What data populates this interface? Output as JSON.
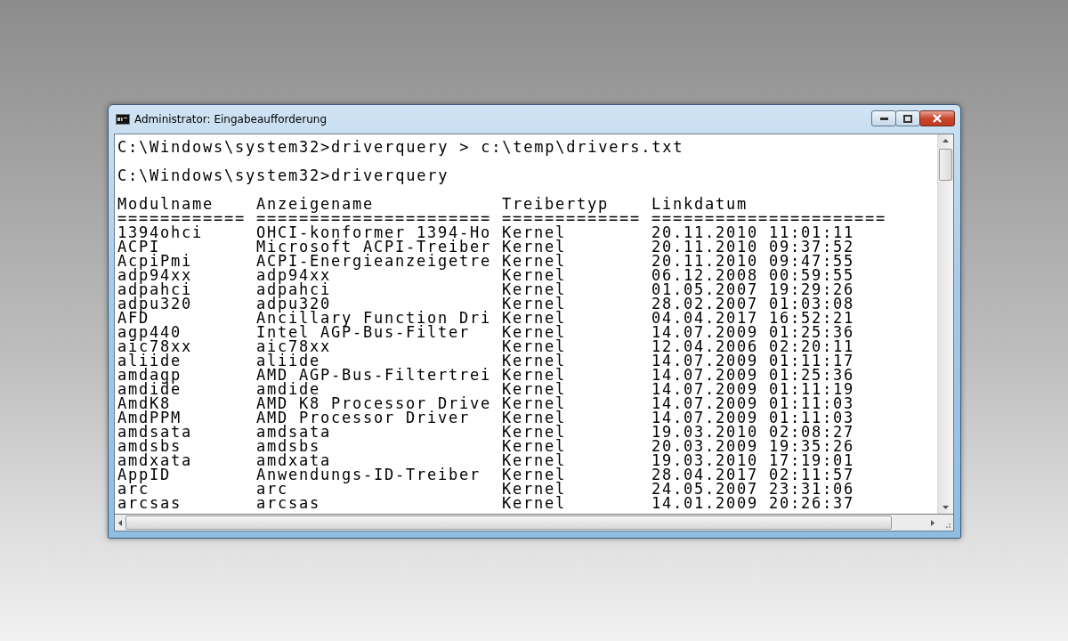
{
  "window": {
    "title": "Administrator: Eingabeaufforderung"
  },
  "console": {
    "commands": [
      "C:\\Windows\\system32>driverquery > c:\\temp\\drivers.txt",
      "C:\\Windows\\system32>driverquery"
    ],
    "table": {
      "columns": [
        {
          "label": "Modulname",
          "rule": "============"
        },
        {
          "label": "Anzeigename",
          "rule": "======================"
        },
        {
          "label": "Treibertyp",
          "rule": "============="
        },
        {
          "label": "Linkdatum",
          "rule": "======================"
        }
      ],
      "rows": [
        [
          "1394ohci",
          "OHCI-konformer 1394-Ho",
          "Kernel",
          "20.11.2010 11:01:11"
        ],
        [
          "ACPI",
          "Microsoft ACPI-Treiber",
          "Kernel",
          "20.11.2010 09:37:52"
        ],
        [
          "AcpiPmi",
          "ACPI-Energieanzeigetre",
          "Kernel",
          "20.11.2010 09:47:55"
        ],
        [
          "adp94xx",
          "adp94xx",
          "Kernel",
          "06.12.2008 00:59:55"
        ],
        [
          "adpahci",
          "adpahci",
          "Kernel",
          "01.05.2007 19:29:26"
        ],
        [
          "adpu320",
          "adpu320",
          "Kernel",
          "28.02.2007 01:03:08"
        ],
        [
          "AFD",
          "Ancillary Function Dri",
          "Kernel",
          "04.04.2017 16:52:21"
        ],
        [
          "agp440",
          "Intel AGP-Bus-Filter",
          "Kernel",
          "14.07.2009 01:25:36"
        ],
        [
          "aic78xx",
          "aic78xx",
          "Kernel",
          "12.04.2006 02:20:11"
        ],
        [
          "aliide",
          "aliide",
          "Kernel",
          "14.07.2009 01:11:17"
        ],
        [
          "amdagp",
          "AMD AGP-Bus-Filtertrei",
          "Kernel",
          "14.07.2009 01:25:36"
        ],
        [
          "amdide",
          "amdide",
          "Kernel",
          "14.07.2009 01:11:19"
        ],
        [
          "AmdK8",
          "AMD K8 Processor Drive",
          "Kernel",
          "14.07.2009 01:11:03"
        ],
        [
          "AmdPPM",
          "AMD Processor Driver",
          "Kernel",
          "14.07.2009 01:11:03"
        ],
        [
          "amdsata",
          "amdsata",
          "Kernel",
          "19.03.2010 02:08:27"
        ],
        [
          "amdsbs",
          "amdsbs",
          "Kernel",
          "20.03.2009 19:35:26"
        ],
        [
          "amdxata",
          "amdxata",
          "Kernel",
          "19.03.2010 17:19:01"
        ],
        [
          "AppID",
          "Anwendungs-ID-Treiber",
          "Kernel",
          "28.04.2017 02:11:57"
        ],
        [
          "arc",
          "arc",
          "Kernel",
          "24.05.2007 23:31:06"
        ],
        [
          "arcsas",
          "arcsas",
          "Kernel",
          "14.01.2009 20:26:37"
        ]
      ]
    }
  }
}
